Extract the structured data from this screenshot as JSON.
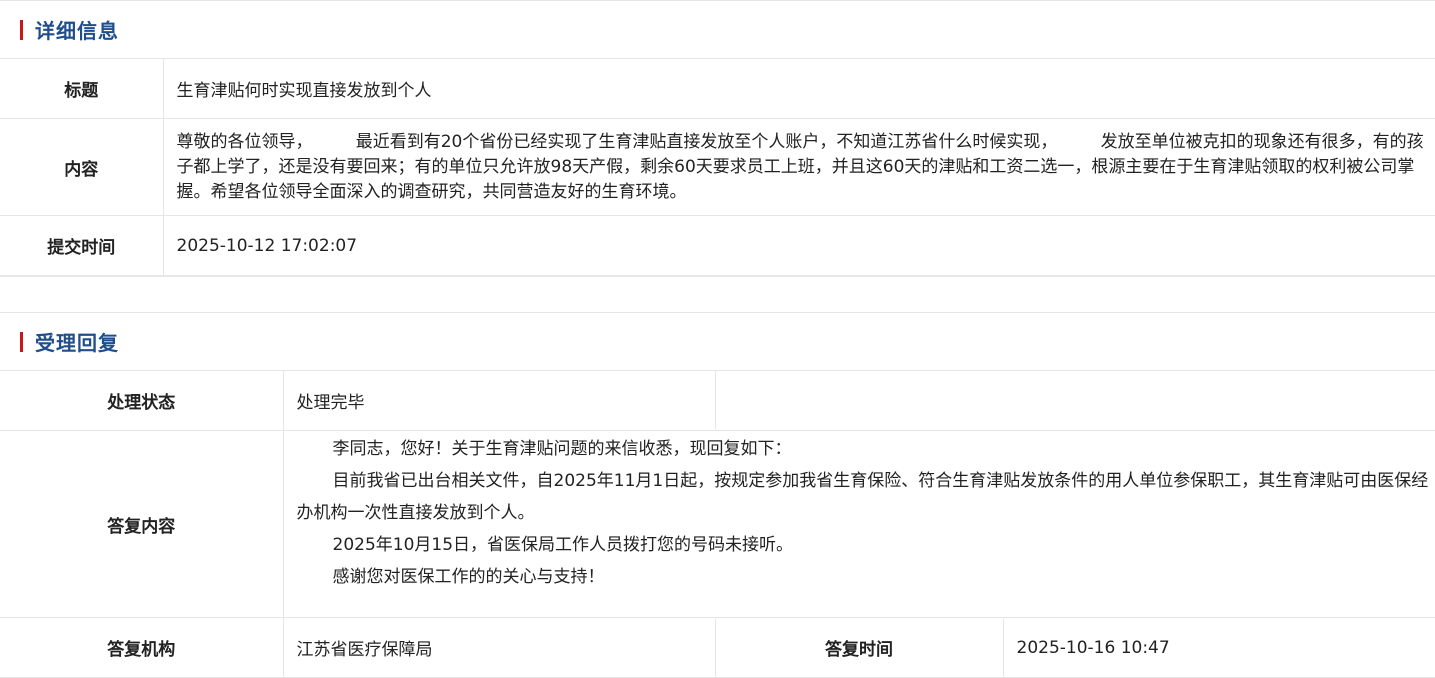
{
  "details": {
    "heading": "详细信息",
    "title_label": "标题",
    "title_value": "生育津贴何时实现直接发放到个人",
    "content_label": "内容",
    "content_value": "尊敬的各位领导，        最近看到有20个省份已经实现了生育津贴直接发放至个人账户，不知道江苏省什么时候实现，        发放至单位被克扣的现象还有很多，有的孩子都上学了，还是没有要回来；有的单位只允许放98天产假，剩余60天要求员工上班，并且这60天的津贴和工资二选一，根源主要在于生育津贴领取的权利被公司掌握。希望各位领导全面深入的调查研究，共同营造友好的生育环境。",
    "time_label": "提交时间",
    "time_value": "2025-10-12 17:02:07"
  },
  "reply": {
    "heading": "受理回复",
    "status_label": "处理状态",
    "status_value": "处理完毕",
    "content_label": "答复内容",
    "paragraphs": [
      "李同志，您好！关于生育津贴问题的来信收悉，现回复如下：",
      "目前我省已出台相关文件，自2025年11月1日起，按规定参加我省生育保险、符合生育津贴发放条件的用人单位参保职工，其生育津贴可由医保经办机构一次性直接发放到个人。",
      "2025年10月15日，省医保局工作人员拨打您的号码未接听。",
      "感谢您对医保工作的的关心与支持！"
    ],
    "org_label": "答复机构",
    "org_value": "江苏省医疗保障局",
    "reply_time_label": "答复时间",
    "reply_time_value": "2025-10-16 10:47"
  },
  "colors": {
    "accent": "#c8161d",
    "heading": "#1f4e8c",
    "border": "#e6e6e6"
  }
}
